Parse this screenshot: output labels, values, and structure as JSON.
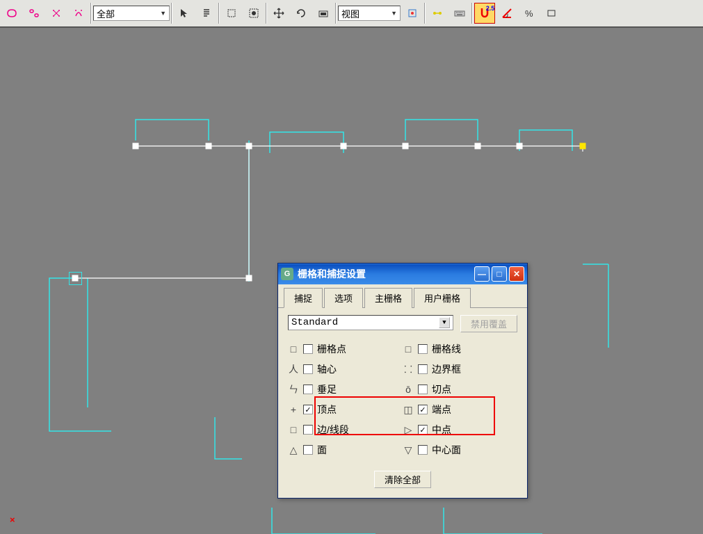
{
  "toolbar": {
    "select_filter": "全部",
    "select_view": "视图",
    "snap_value": "2.5"
  },
  "dialog": {
    "title": "栅格和捕捉设置",
    "tabs": [
      "捕捉",
      "选项",
      "主栅格",
      "用户栅格"
    ],
    "active_tab": 0,
    "combo_value": "Standard",
    "disable_override": "禁用覆盖",
    "options_left": [
      {
        "sym": "□",
        "label": "栅格点",
        "checked": false
      },
      {
        "sym": "人",
        "label": "轴心",
        "checked": false
      },
      {
        "sym": "ㄣ",
        "label": "垂足",
        "checked": false
      },
      {
        "sym": "+",
        "label": "顶点",
        "checked": true
      },
      {
        "sym": "□",
        "label": "边/线段",
        "checked": false
      },
      {
        "sym": "△",
        "label": "面",
        "checked": false
      }
    ],
    "options_right": [
      {
        "sym": "□",
        "label": "栅格线",
        "checked": false
      },
      {
        "sym": "⸬",
        "label": "边界框",
        "checked": false
      },
      {
        "sym": "ō",
        "label": "切点",
        "checked": false
      },
      {
        "sym": "◫",
        "label": "端点",
        "checked": true
      },
      {
        "sym": "▷",
        "label": "中点",
        "checked": true
      },
      {
        "sym": "▽",
        "label": "中心面",
        "checked": false
      }
    ],
    "clear_all": "清除全部"
  }
}
